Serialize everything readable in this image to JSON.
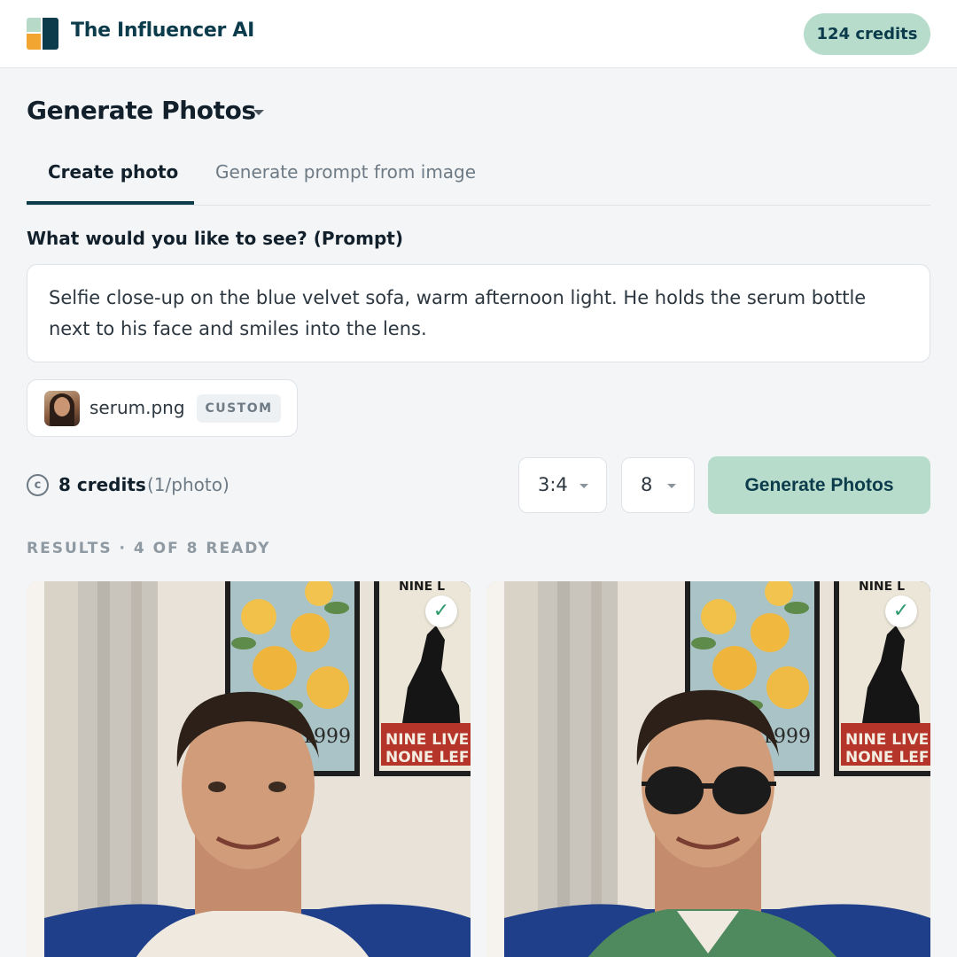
{
  "header": {
    "brand": "The Influencer AI",
    "credits": "124 credits"
  },
  "page": {
    "title": "Generate Photos"
  },
  "tabs": [
    {
      "label": "Create photo",
      "active": true
    },
    {
      "label": "Generate prompt from image",
      "active": false
    }
  ],
  "prompt": {
    "label": "What would you like to see? (Prompt)",
    "value": "Selfie close-up on the blue velvet sofa, warm afternoon light. He holds the serum bottle next to his face and smiles into the lens."
  },
  "attachment": {
    "file_name": "serum.png",
    "badge": "CUSTOM"
  },
  "cost": {
    "coin_symbol": "c",
    "amount": "8 credits",
    "rate": "(1/photo)"
  },
  "options": {
    "aspect_ratio": "3:4",
    "count": "8"
  },
  "generate_button": "Generate Photos",
  "results": {
    "label": "RESULTS · 4 OF 8 READY",
    "items": [
      {
        "status": "ready",
        "check": "✓",
        "poster_year": "1999",
        "poster_text_1": "NINE LIVE",
        "poster_text_2": "NONE LEF",
        "poster_header": "NINE L",
        "sunglasses": false
      },
      {
        "status": "ready",
        "check": "✓",
        "poster_year": "1999",
        "poster_text_1": "NINE LIVE",
        "poster_text_2": "NONE LEF",
        "poster_header": "NINE L",
        "sunglasses": true
      }
    ]
  },
  "colors": {
    "brand": "#0c3b4b",
    "accent": "#b7dccb",
    "success": "#2b9a6c"
  }
}
